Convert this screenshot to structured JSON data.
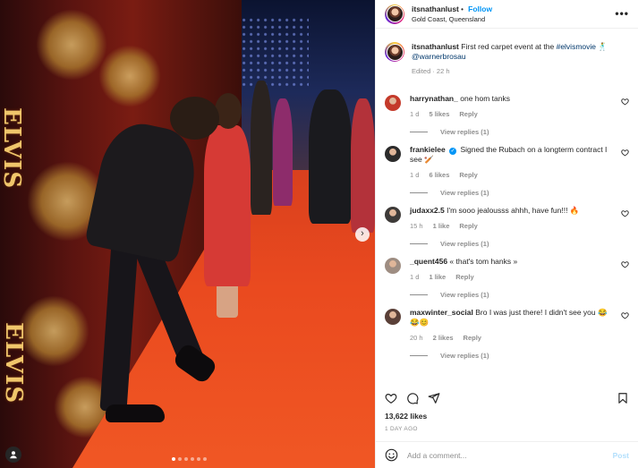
{
  "post": {
    "username": "itsnathanlust",
    "follow_label": "Follow",
    "location": "Gold Coast, Queensland",
    "more_label": "•••",
    "caption": {
      "username": "itsnathanlust",
      "text_before": "First red carpet event at the ",
      "hashtag": "#elvismovie",
      "emoji": "🕺",
      "mention": "@warnerbrosau",
      "meta": "Edited · 22 h"
    },
    "likes": "13,622 likes",
    "date": "1 DAY AGO",
    "photo": {
      "wall_text_1": "ELVIS",
      "wall_text_2": "ELVIS",
      "carousel_dots": 6,
      "active_dot": 0,
      "next_label": "›"
    }
  },
  "comments": [
    {
      "username": "harrynathan_",
      "verified": false,
      "text": "one hom tanks",
      "time": "1 d",
      "likes": "5 likes",
      "reply_label": "Reply",
      "view_replies": "View replies (1)",
      "avatar_color": "#c43a2a"
    },
    {
      "username": "frankielee",
      "verified": true,
      "text": "Signed the Rubach on a longterm contract I see 🏏",
      "time": "1 d",
      "likes": "6 likes",
      "reply_label": "Reply",
      "view_replies": "View replies (1)",
      "avatar_color": "#2b2b2b"
    },
    {
      "username": "judaxx2.5",
      "verified": false,
      "text": "I'm sooo jealousss ahhh, have fun!!! 🔥",
      "time": "15 h",
      "likes": "1 like",
      "reply_label": "Reply",
      "view_replies": "View replies (1)",
      "avatar_color": "#3d3a38"
    },
    {
      "username": "_quent456",
      "verified": false,
      "text": "« that's tom hanks »",
      "time": "1 d",
      "likes": "1 like",
      "reply_label": "Reply",
      "view_replies": "View replies (1)",
      "avatar_color": "#9e8d82"
    },
    {
      "username": "maxwinter_social",
      "verified": false,
      "text": "Bro I was just there! I didn't see you 😂😂😊",
      "time": "20 h",
      "likes": "2 likes",
      "reply_label": "Reply",
      "view_replies": "View replies (1)",
      "avatar_color": "#5a4038"
    }
  ],
  "footer": {
    "placeholder": "Add a comment...",
    "post_label": "Post"
  },
  "colors": {
    "accent": "#0095f6",
    "link": "#00376b",
    "muted": "#8e8e8e",
    "carpet": "#ea4a1f"
  }
}
